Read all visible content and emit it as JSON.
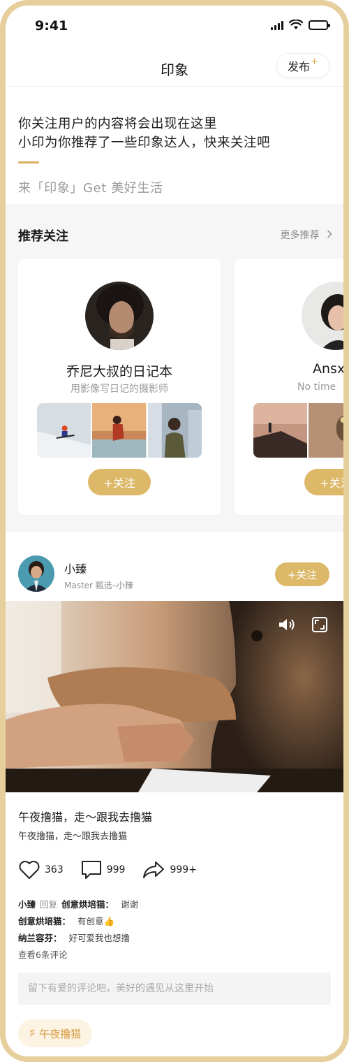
{
  "status_bar": {
    "time": "9:41"
  },
  "nav": {
    "title": "印象",
    "publish_label": "发布",
    "publish_plus": "+"
  },
  "intro": {
    "line1": "你关注用户的内容将会出现在这里",
    "line2": "小印为你推荐了一些印象达人，快来关注吧",
    "subtitle": "来「印象」Get 美好生活"
  },
  "recommend": {
    "title": "推荐关注",
    "more_label": "更多推荐",
    "cards": [
      {
        "name": "乔尼大叔的日记本",
        "desc": "用影像写日记的摄影师",
        "follow_label": "+关注"
      },
      {
        "name": "Ansx",
        "desc": "No time",
        "follow_label": "+关注"
      }
    ]
  },
  "post": {
    "user": "小臻",
    "meta": "Master 甄选–小臻",
    "follow_label": "+关注",
    "title": "午夜撸猫，走～跟我去撸猫",
    "subtitle": "午夜撸猫，走～跟我去撸猫",
    "likes": "363",
    "comments_count": "999",
    "shares": "999+",
    "comments": [
      {
        "user": "小臻",
        "reply_word": "回复",
        "reply_to": "创意烘培猫：",
        "text": "谢谢"
      },
      {
        "user": "创意烘培猫：",
        "text": "有创意👍"
      },
      {
        "user": "纳兰容芬：",
        "text": "好可爱我也想撸"
      }
    ],
    "view_all": "查看6条评论",
    "input_placeholder": "留下有爱的评论吧，美好的遇见从这里开始",
    "tag": "午夜撸猫"
  },
  "colors": {
    "accent": "#dcb868",
    "frame": "#e6cf9c",
    "tag_text": "#d59a3c"
  }
}
